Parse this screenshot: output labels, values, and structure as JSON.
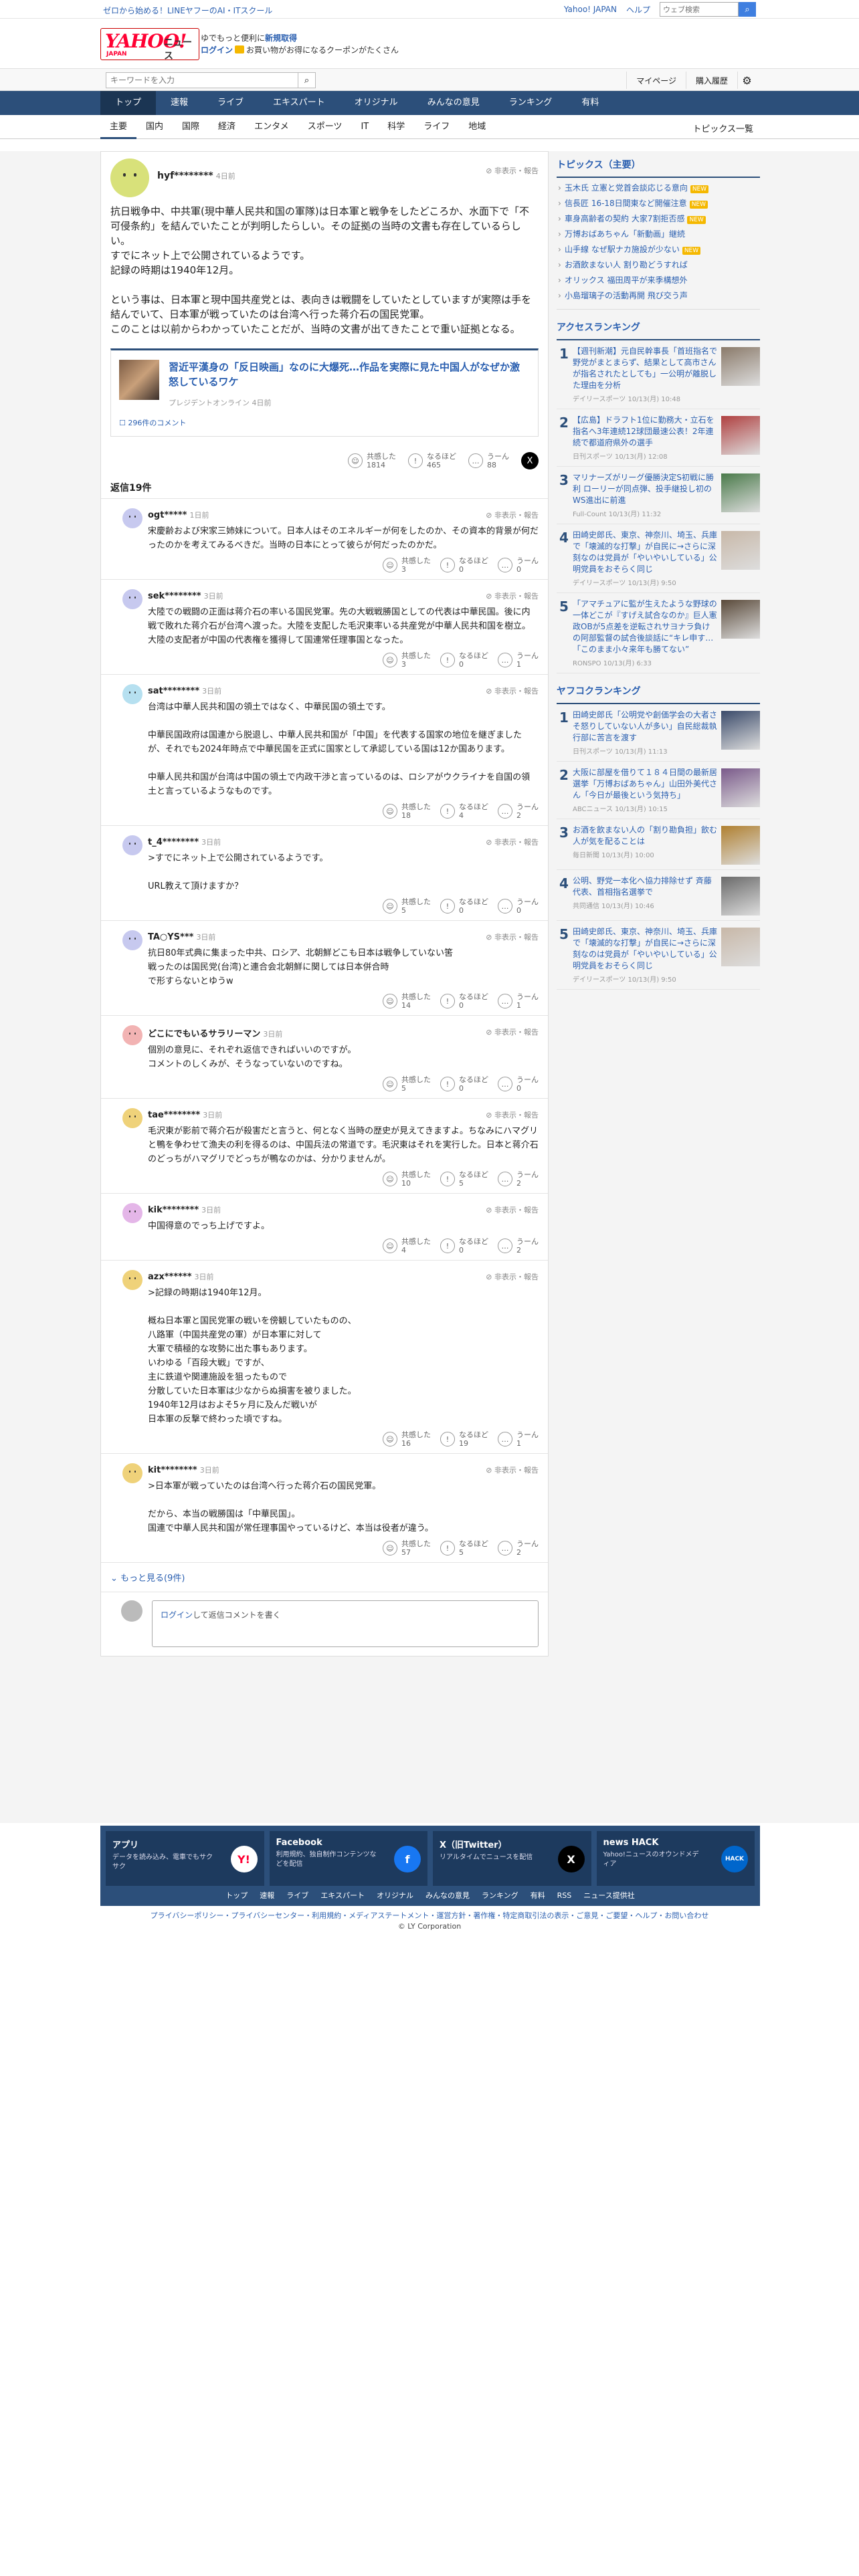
{
  "topbar": {
    "promo": "ゼロから始める！LINEヤフーのAI・ITスクール",
    "links": [
      "Yahoo! JAPAN",
      "ヘルプ"
    ],
    "search_placeholder": "ウェブ検索",
    "search_label": "キーワードを入力"
  },
  "masthead": {
    "logo_text": "YAHOO!",
    "logo_sub": "JAPAN",
    "logo_service": "ニュース",
    "line1_prefix": "ゆでもっと便利に",
    "line1_link": "新規取得",
    "login": "ログイン",
    "line2": "お買い物がお得になるクーポンがたくさん"
  },
  "searchbar": {
    "placeholder": "キーワードを入力",
    "mypage": "マイページ",
    "history": "購入履歴"
  },
  "nav_main": [
    "トップ",
    "速報",
    "ライブ",
    "エキスパート",
    "オリジナル",
    "みんなの意見",
    "ランキング",
    "有料"
  ],
  "nav_sub": [
    "主要",
    "国内",
    "国際",
    "経済",
    "エンタメ",
    "スポーツ",
    "IT",
    "科学",
    "ライフ",
    "地域"
  ],
  "nav_sub_right": "トピックス一覧",
  "main": {
    "user": "hyf********",
    "time": "4日前",
    "report": "非表示・報告",
    "body": [
      "抗日戦争中、中共軍(現中華人民共和国の軍隊)は日本軍と戦争をしたどころか、水面下で「不可侵条約」を結んでいたことが判明したらしい。その証拠の当時の文書も存在しているらしい。",
      "すでにネット上で公開されているようです。",
      "記録の時期は1940年12月。",
      "",
      "という事は、日本軍と現中国共産党とは、表向きは戦闘をしていたとしていますが実際は手を結んでいて、日本軍が戦っていたのは台湾へ行った蒋介石の国民党軍。",
      "このことは以前からわかっていたことだが、当時の文書が出てきたことで重い証拠となる。"
    ],
    "article": {
      "title": "習近平漢身の「反日映画」なのに大爆死…作品を実際に見た中国人がなぜか激怒しているワケ",
      "source": "プレジデントオンライン 4日前",
      "comments": "296件のコメント"
    },
    "reactions": {
      "a_label": "共感した",
      "a": "1814",
      "b_label": "なるほど",
      "b": "465",
      "c_label": "うーん",
      "c": "88"
    },
    "reply_count": "返信19件",
    "more": "もっと見る(9件)",
    "compose_login": "ログイン",
    "compose_text": "して返信コメントを書く"
  },
  "replies": [
    {
      "user": "ogt*****",
      "time": "1日前",
      "color": "#c7c9ef",
      "body": "宋慶齢および宋家三姉妹について。日本人はそのエネルギーが何をしたのか、その資本的背景が何だったのかを考えてみるべきだ。当時の日本にとって彼らが何だったのかだ。",
      "a": "3",
      "b": "0",
      "c": "0"
    },
    {
      "user": "sek********",
      "time": "3日前",
      "color": "#c7c9ef",
      "body": "大陸での戦闘の正面は蒋介石の率いる国民党軍。先の大戦戦勝国としての代表は中華民国。後に内戦で敗れた蒋介石が台湾へ渡った。大陸を支配した毛沢東率いる共産党が中華人民共和国を樹立。大陸の支配者が中国の代表権を獲得して国連常任理事国となった。",
      "a": "3",
      "b": "0",
      "c": "1"
    },
    {
      "user": "sat********",
      "time": "3日前",
      "color": "#b6e0f0",
      "body": "台湾は中華人民共和国の領土ではなく、中華民国の領土です。\n\n中華民国政府は国連から脱退し、中華人民共和国が「中国」を代表する国家の地位を継ぎましたが、それでも2024年時点で中華民国を正式に国家として承認している国は12か国あります。\n\n中華人民共和国が台湾は中国の領土で内政干渉と言っているのは、ロシアがウクライナを自国の領土と言っているようなものです。",
      "a": "18",
      "b": "4",
      "c": "2"
    },
    {
      "user": "t_4********",
      "time": "3日前",
      "color": "#c7c9ef",
      "body": ">すでにネット上で公開されているようです。\n\nURL教えて頂けますか？",
      "a": "5",
      "b": "0",
      "c": "0"
    },
    {
      "user": "TA○YS***",
      "time": "3日前",
      "color": "#c7c9ef",
      "body": "抗日80年式典に集まった中共、ロシア、北朝鮮どこも日本は戦争していない筈\n戦ったのは国民党(台湾)と連合会北朝鮮に関しては日本併合時\nで形すらないとゆうw",
      "a": "14",
      "b": "0",
      "c": "1"
    },
    {
      "user": "どこにでもいるサラリーマン",
      "time": "3日前",
      "color": "#f2b3b3",
      "body": "個別の意見に、それぞれ返信できればいいのですが。\nコメントのしくみが、そうなっていないのですね。",
      "a": "5",
      "b": "0",
      "c": "0"
    },
    {
      "user": "tae********",
      "time": "3日前",
      "color": "#efd27a",
      "body": "毛沢東が影前で蒋介石が殺害だと言うと、何となく当時の歴史が見えてきますよ。ちなみにハマグリと鴨を争わせて漁夫の利を得るのは、中国兵法の常道です。毛沢東はそれを実行した。日本と蒋介石のどっちがハマグリでどっちが鴨なのかは、分かりませんが。",
      "a": "10",
      "b": "5",
      "c": "2"
    },
    {
      "user": "kik********",
      "time": "3日前",
      "color": "#e4b6e8",
      "body": "中国得意のでっち上げですよ。",
      "a": "4",
      "b": "0",
      "c": "2"
    },
    {
      "user": "azx******",
      "time": "3日前",
      "color": "#efd27a",
      "body": ">記録の時期は1940年12月。\n\n概ね日本軍と国民党軍の戦いを傍観していたものの、\n八路軍（中国共産党の軍）が日本軍に対して\n大軍で積極的な攻勢に出た事もあります。\nいわゆる「百段大戦」ですが、\n主に鉄道や関連施設を狙ったもので\n分散していた日本軍は少なからぬ損害を被りました。\n1940年12月はおよそ5ヶ月に及んだ戦いが\n日本軍の反撃で終わった頃ですね。",
      "a": "16",
      "b": "19",
      "c": "1"
    },
    {
      "user": "kit********",
      "time": "3日前",
      "color": "#efd27a",
      "body": ">日本軍が戦っていたのは台湾へ行った蒋介石の国民党軍。\n\nだから、本当の戦勝国は「中華民国」。\n国連で中華人民共和国が常任理事国やっているけど、本当は役者が違う。",
      "a": "57",
      "b": "5",
      "c": "2"
    }
  ],
  "side": {
    "topics_title": "トピックス（主要）",
    "topics": [
      {
        "text": "玉木氏 立憲と党首会談応じる意向",
        "badge": "NEW"
      },
      {
        "text": "信長匠 16-18日間東など開催注意",
        "badge": "NEW"
      },
      {
        "text": "車身高齢者の契約 大家7割拒否感",
        "badge": "NEW"
      },
      {
        "text": "万博おばあちゃん「新動画」継続",
        "badge": ""
      },
      {
        "text": "山手線 なぜ駅ナカ施設が少ない",
        "badge": "NEW"
      },
      {
        "text": "お酒飲まない人 割り勘どうすれば",
        "badge": ""
      },
      {
        "text": "オリックス 福田周平が来季構想外",
        "badge": ""
      },
      {
        "text": "小島瑠璃子の活動再開 飛び交う声",
        "badge": ""
      }
    ],
    "access_title": "アクセスランキング",
    "access": [
      {
        "n": "1",
        "t": "【週刊新潮】元自民幹事長「首班指名で野党がまとまらず、結果として高市さんが指名されたとしても」一公明が離脱した理由を分析",
        "m": "デイリースポーツ 10/13(月) 10:48",
        "c": "#8a7a6a"
      },
      {
        "n": "2",
        "t": "【広島】ドラフト1位に勤務大・立石を指名へ3年連続12球団最速公表！2年連続で都道府県外の選手",
        "m": "日刊スポーツ 10/13(月) 12:08",
        "c": "#b04040"
      },
      {
        "n": "3",
        "t": "マリナーズがリーグ優勝決定S初戦に勝利 ローリーが同点弾、投手継投し初のWS進出に前進",
        "m": "Full-Count 10/13(月) 11:32",
        "c": "#4a7a4a"
      },
      {
        "n": "4",
        "t": "田崎史郎氏、東京、神奈川、埼玉、兵庫で「壊滅的な打撃」が自民に→さらに深刻なのは党員が「やいやいしている」公明党員をおそらく同じ",
        "m": "デイリースポーツ 10/13(月) 9:50",
        "c": "#c8b8a8"
      },
      {
        "n": "5",
        "t": "「アマチュアに監が生えたような野球の一体どこが『すげえ試合なのか』巨人憲政OBが5点差を逆転されサヨナラ負けの阿部監督の試合後談話に“キレ申す…「このまま小々来年も勝てない”",
        "m": "RONSPO 10/13(月) 6:33",
        "c": "#5a4a3a"
      }
    ],
    "yahoo_title": "ヤフコクランキング",
    "yahoo": [
      {
        "n": "1",
        "t": "田崎史郎氏「公明党や創価学会の大者さそ怒りしていない人が多い」自民総裁執行部に苦言を渡す",
        "m": "日刊スポーツ 10/13(月) 11:13",
        "c": "#3a4a6a"
      },
      {
        "n": "2",
        "t": "大阪に部屋を借りて１８４日間の最新居選挙「万博おばあちゃん」山田外美代さん「今日が最後という気持ち」",
        "m": "ABCニュース 10/13(月) 10:15",
        "c": "#7a5a8a"
      },
      {
        "n": "3",
        "t": "お酒を飲まない人の「割り勘負担」飲む人が気を配ることは",
        "m": "毎日新聞 10/13(月) 10:00",
        "c": "#b08030"
      },
      {
        "n": "4",
        "t": "公明、野党一本化へ協力排除せず 斉藤代表、首相指名選挙で",
        "m": "共同通信 10/13(月) 10:46",
        "c": "#6a6a6a"
      },
      {
        "n": "5",
        "t": "田崎史郎氏、東京、神奈川、埼玉、兵庫で「壊滅的な打撃」が自民に→さらに深刻なのは党員が「やいやいしている」公明党員をおそらく同じ",
        "m": "デイリースポーツ 10/13(月) 9:50",
        "c": "#c8b8a8"
      }
    ]
  },
  "footer": {
    "cards": [
      {
        "t": "アプリ",
        "d": "データを読み込み、電車でもサクサク",
        "i": "Y!",
        "bg": "#ffffff",
        "fg": "#ff0033"
      },
      {
        "t": "Facebook",
        "d": "利用規約、独自制作コンテンツなどを配信",
        "i": "f",
        "bg": "#1877f2",
        "fg": "#ffffff"
      },
      {
        "t": "X（旧Twitter）",
        "d": "リアルタイムでニュースを配信",
        "i": "X",
        "bg": "#000000",
        "fg": "#ffffff"
      },
      {
        "t": "news HACK",
        "d": "Yahoo!ニュースのオウンドメディア",
        "i": "HACK",
        "bg": "#0066cc",
        "fg": "#ffffff"
      }
    ],
    "nav": [
      "トップ",
      "速報",
      "ライブ",
      "エキスパート",
      "オリジナル",
      "みんなの意見",
      "ランキング",
      "有料",
      "RSS",
      "ニュース提供社"
    ],
    "links": "プライバシーポリシー・プライバシーセンター・利用規約・メディアステートメント・運営方針・著作権・特定商取引法の表示・ご意見・ご要望・ヘルプ・お問い合わせ",
    "copyright": "© LY Corporation"
  },
  "colors": {
    "navy": "#2c4f7a",
    "link": "#2a5fb0",
    "brand": "#ff0033"
  }
}
